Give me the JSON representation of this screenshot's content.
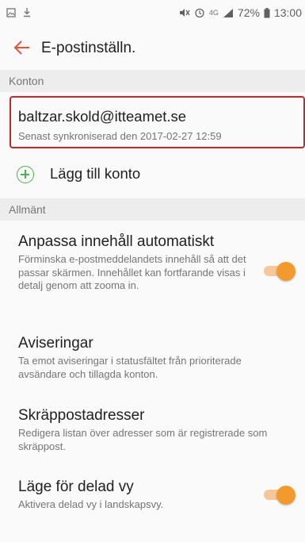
{
  "status_bar": {
    "battery": "72%",
    "time": "13:00",
    "network": "4G"
  },
  "app_bar": {
    "title": "E-postinställn."
  },
  "sections": {
    "accounts_header": "Konton",
    "general_header": "Allmänt"
  },
  "account": {
    "email": "baltzar.skold@itteamet.se",
    "sync_text": "Senast synkroniserad den 2017-02-27  12:59"
  },
  "add_account": {
    "label": "Lägg till konto"
  },
  "settings": [
    {
      "title": "Anpassa innehåll automatiskt",
      "description": "Förminska e-postmeddelandets innehåll så att det passar skärmen. Innehållet kan fortfarande visas i detalj genom att zooma in.",
      "toggle": true
    },
    {
      "title": "Aviseringar",
      "description": "Ta emot aviseringar i statusfältet från prioriterade avsändare och tillagda konton."
    },
    {
      "title": "Skräppostadresser",
      "description": "Redigera listan över adresser som är registrerade som skräppost."
    },
    {
      "title": "Läge för delad vy",
      "description": "Aktivera delad vy i landskapsvy.",
      "toggle": true
    }
  ],
  "colors": {
    "accent_toggle": "#f39a2e",
    "back_arrow": "#e5533d",
    "highlight_border": "#c62828",
    "add_icon": "#4caf50"
  }
}
